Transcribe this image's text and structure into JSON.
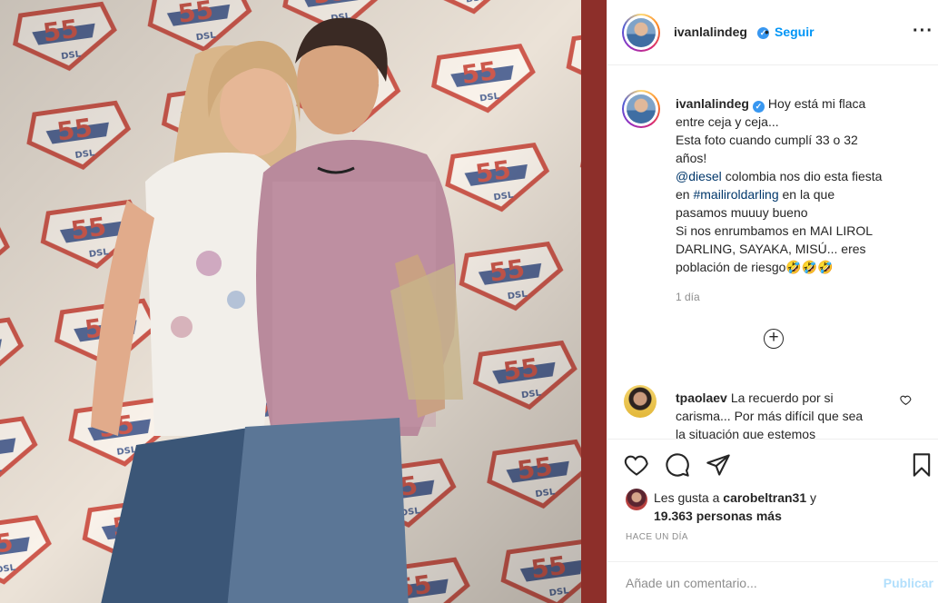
{
  "post_header": {
    "username": "ivanlalindeg",
    "separator": "•",
    "follow_label": "Seguir",
    "more_icon": "ellipsis-icon",
    "verified_icon": "verified-badge-icon"
  },
  "photo": {
    "backdrop_logo_text": "DSL",
    "backdrop_numeral": "55"
  },
  "caption": {
    "username": "ivanlalindeg",
    "lines": [
      "Hoy está mi flaca",
      "entre ceja y ceja...",
      "Esta foto cuando cumplí 33 o 32",
      "años!"
    ],
    "mention": "@diesel",
    "mention_rest": "colombia nos dio esta fiesta",
    "hashtag_prefix": "en",
    "hashtag": "#mailiroldarling",
    "hashtag_rest": "en la que",
    "lines2": [
      "pasamos muuuy bueno",
      "Si nos enrumbamos en MAI LIROL",
      "DARLING, SAYAKA, MISÚ... eres"
    ],
    "last_line": "población de riesgo",
    "emoji": "🤣🤣🤣",
    "time": "1 día"
  },
  "load_more_icon": "plus-circle-icon",
  "comment": {
    "username": "tpaolaev",
    "text_line1": "La recuerdo por si",
    "text_line2": "carisma... Por más difícil que sea",
    "text_line3": "la situación que estemos",
    "heart_icon": "heart-outline-icon"
  },
  "actions": {
    "like_icon": "heart-icon",
    "comment_icon": "comment-icon",
    "share_icon": "paper-plane-icon",
    "save_icon": "bookmark-icon"
  },
  "likes": {
    "prefix": "Les gusta a",
    "user": "carobeltran31",
    "conj": "y",
    "count": "19.363 personas más"
  },
  "timestamp": "HACE UN DÍA",
  "add_comment": {
    "placeholder": "Añade un comentario...",
    "publish_label": "Publicar"
  },
  "colors": {
    "accent": "#0095f6",
    "publish_disabled": "#b2dffc",
    "text": "#262626",
    "muted": "#8e8e8e",
    "link": "#00376b"
  }
}
